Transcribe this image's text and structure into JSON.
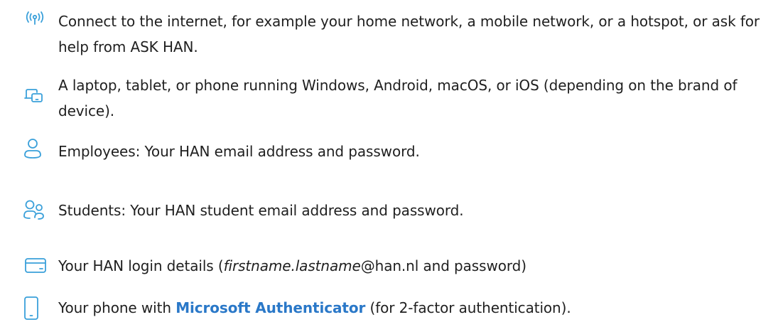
{
  "accent_color": "#3aa0da",
  "link_color": "#2a78c8",
  "requirements": [
    {
      "icon": "wifi-signal-icon",
      "text": "Connect to the internet, for example your home network, a mobile network, or a hotspot, or ask for help from ASK HAN."
    },
    {
      "icon": "devices-icon",
      "text": "A laptop, tablet, or phone running Windows, Android, macOS, or iOS (depending on the brand of device)."
    },
    {
      "icon": "person-icon",
      "text": "Employees: Your HAN email address and password."
    },
    {
      "icon": "people-icon",
      "text": "Students: Your HAN student email address and password."
    },
    {
      "icon": "credit-card-icon",
      "text_italic": "firstname.lastname",
      "text_before": "Your HAN login details (",
      "text_after": "@han.nl and password)"
    },
    {
      "icon": "phone-icon",
      "text_before": "Your phone with ",
      "link_text": "Microsoft Authenticator",
      "text_after": " (for 2-factor authentication)."
    }
  ]
}
